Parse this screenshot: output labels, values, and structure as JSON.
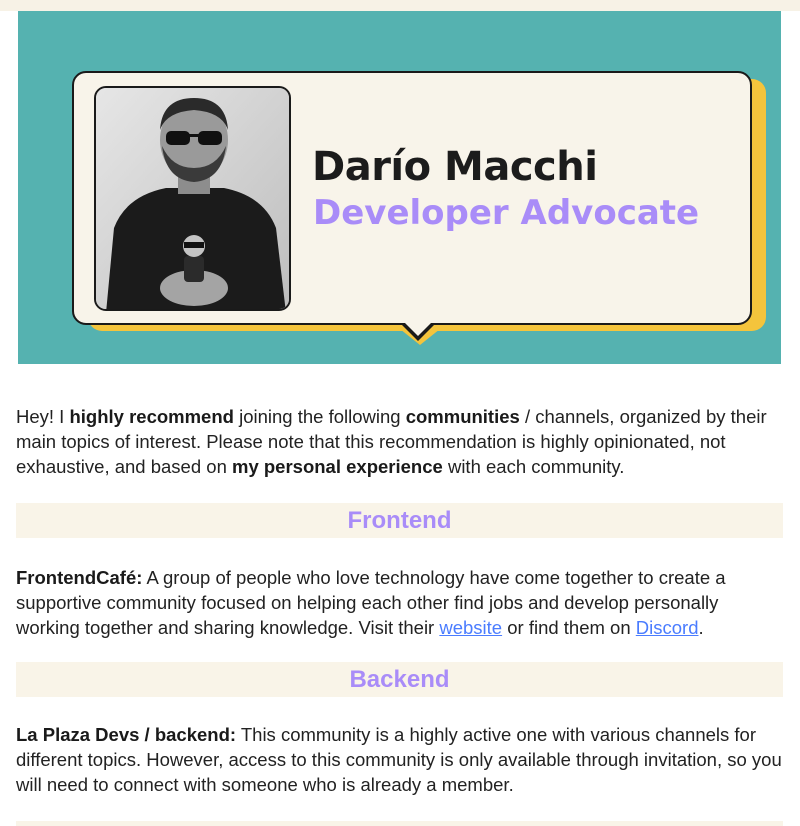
{
  "hero": {
    "name": "Darío Macchi",
    "role": "Developer Advocate"
  },
  "intro": {
    "t1": "Hey! I ",
    "b1": "highly recommend",
    "t2": " joining the following ",
    "b2": "communities",
    "t3": " / channels, organized by their main topics of interest. Please note that this recommendation is highly opinionated, not exhaustive, and based on ",
    "b3": "my personal experience",
    "t4": " with each community."
  },
  "sections": {
    "frontend": {
      "title": "Frontend",
      "name": "FrontendCafé:",
      "text1": " A group of people who love technology have come together to create a supportive community focused on helping each other find jobs and develop personally working together and sharing knowledge. Visit their ",
      "link1": "website",
      "text2": " or find them on ",
      "link2": "Discord",
      "text3": "."
    },
    "backend": {
      "title": "Backend",
      "name": "La Plaza Devs / backend:",
      "text1": " This community is a highly active one with various channels for different topics. However, access to this community is only available through invitation, so you will need to connect with someone who is already a member."
    }
  },
  "colors": {
    "hero_bg": "#55b2b0",
    "bubble_shadow": "#f4c43c",
    "accent_purple": "#a98cf8",
    "section_bar": "#f9f4e8",
    "link": "#4a7cff"
  }
}
